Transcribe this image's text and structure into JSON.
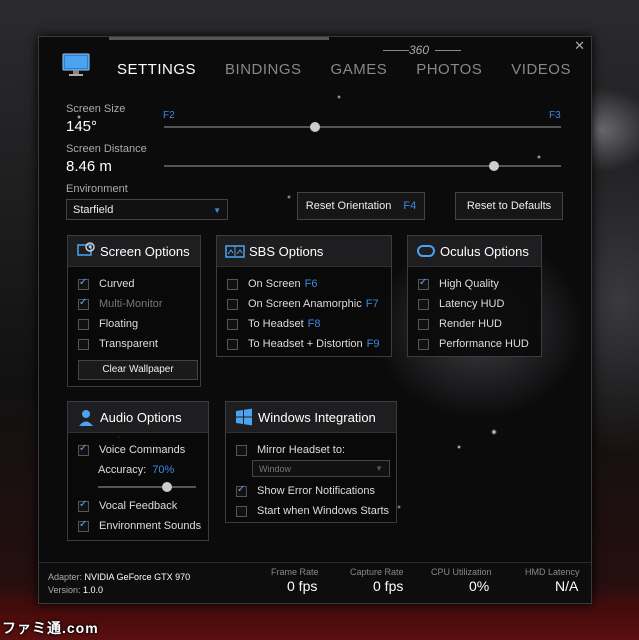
{
  "nav": {
    "tabs": [
      {
        "label": "SETTINGS"
      },
      {
        "label": "BINDINGS"
      },
      {
        "label": "GAMES"
      },
      {
        "label": "PHOTOS"
      },
      {
        "label": "VIDEOS"
      }
    ],
    "badge": "360"
  },
  "screen_size": {
    "label": "Screen Size",
    "value": "145°",
    "key_left": "F2",
    "key_right": "F3",
    "level": 0.38
  },
  "screen_distance": {
    "label": "Screen Distance",
    "value": "8.46 m",
    "level": 0.83
  },
  "environment": {
    "label": "Environment",
    "selected": "Starfield"
  },
  "buttons": {
    "reset_orientation": "Reset Orientation",
    "reset_orientation_key": "F4",
    "reset_defaults": "Reset to Defaults"
  },
  "screen_options": {
    "title": "Screen Options",
    "items": [
      {
        "label": "Curved",
        "checked": true
      },
      {
        "label": "Multi-Monitor",
        "checked": true,
        "disabled": true
      },
      {
        "label": "Floating",
        "checked": false
      },
      {
        "label": "Transparent",
        "checked": false
      }
    ],
    "clear_wallpaper": "Clear Wallpaper"
  },
  "sbs_options": {
    "title": "SBS Options",
    "items": [
      {
        "label": "On Screen",
        "key": "F6",
        "checked": false
      },
      {
        "label": "On Screen Anamorphic",
        "key": "F7",
        "checked": false
      },
      {
        "label": "To Headset",
        "key": "F8",
        "checked": false
      },
      {
        "label": "To Headset + Distortion",
        "key": "F9",
        "checked": false
      }
    ]
  },
  "oculus_options": {
    "title": "Oculus Options",
    "items": [
      {
        "label": "High Quality",
        "checked": true
      },
      {
        "label": "Latency HUD",
        "checked": false
      },
      {
        "label": "Render HUD",
        "checked": false
      },
      {
        "label": "Performance HUD",
        "checked": false
      }
    ]
  },
  "audio_options": {
    "title": "Audio Options",
    "voice_commands": "Voice Commands",
    "accuracy_label": "Accuracy:",
    "accuracy_value": "70%",
    "accuracy_level": 0.7,
    "vocal_feedback": "Vocal Feedback",
    "environment_sounds": "Environment Sounds"
  },
  "windows_integration": {
    "title": "Windows Integration",
    "mirror_headset": "Mirror Headset to:",
    "mirror_select": "Window",
    "show_errors": "Show Error Notifications",
    "start_with_windows": "Start when Windows Starts"
  },
  "footer": {
    "adapter_label": "Adapter:",
    "adapter_value": "NVIDIA GeForce GTX 970",
    "version_label": "Version:",
    "version_value": "1.0.0",
    "frame_rate_label": "Frame Rate",
    "frame_rate_value": "0 fps",
    "capture_rate_label": "Capture Rate",
    "capture_rate_value": "0 fps",
    "cpu_label": "CPU Utilization",
    "cpu_value": "0%",
    "hmd_label": "HMD Latency",
    "hmd_value": "N/A"
  },
  "watermark": "ファミ通.com",
  "colors": {
    "accent": "#3a8be0"
  },
  "icons": [
    "monitor-icon",
    "close-icon",
    "screen-gear-icon",
    "sbs-icon",
    "oculus-icon",
    "headset-icon",
    "windows-icon",
    "dropdown-arrow-icon"
  ]
}
